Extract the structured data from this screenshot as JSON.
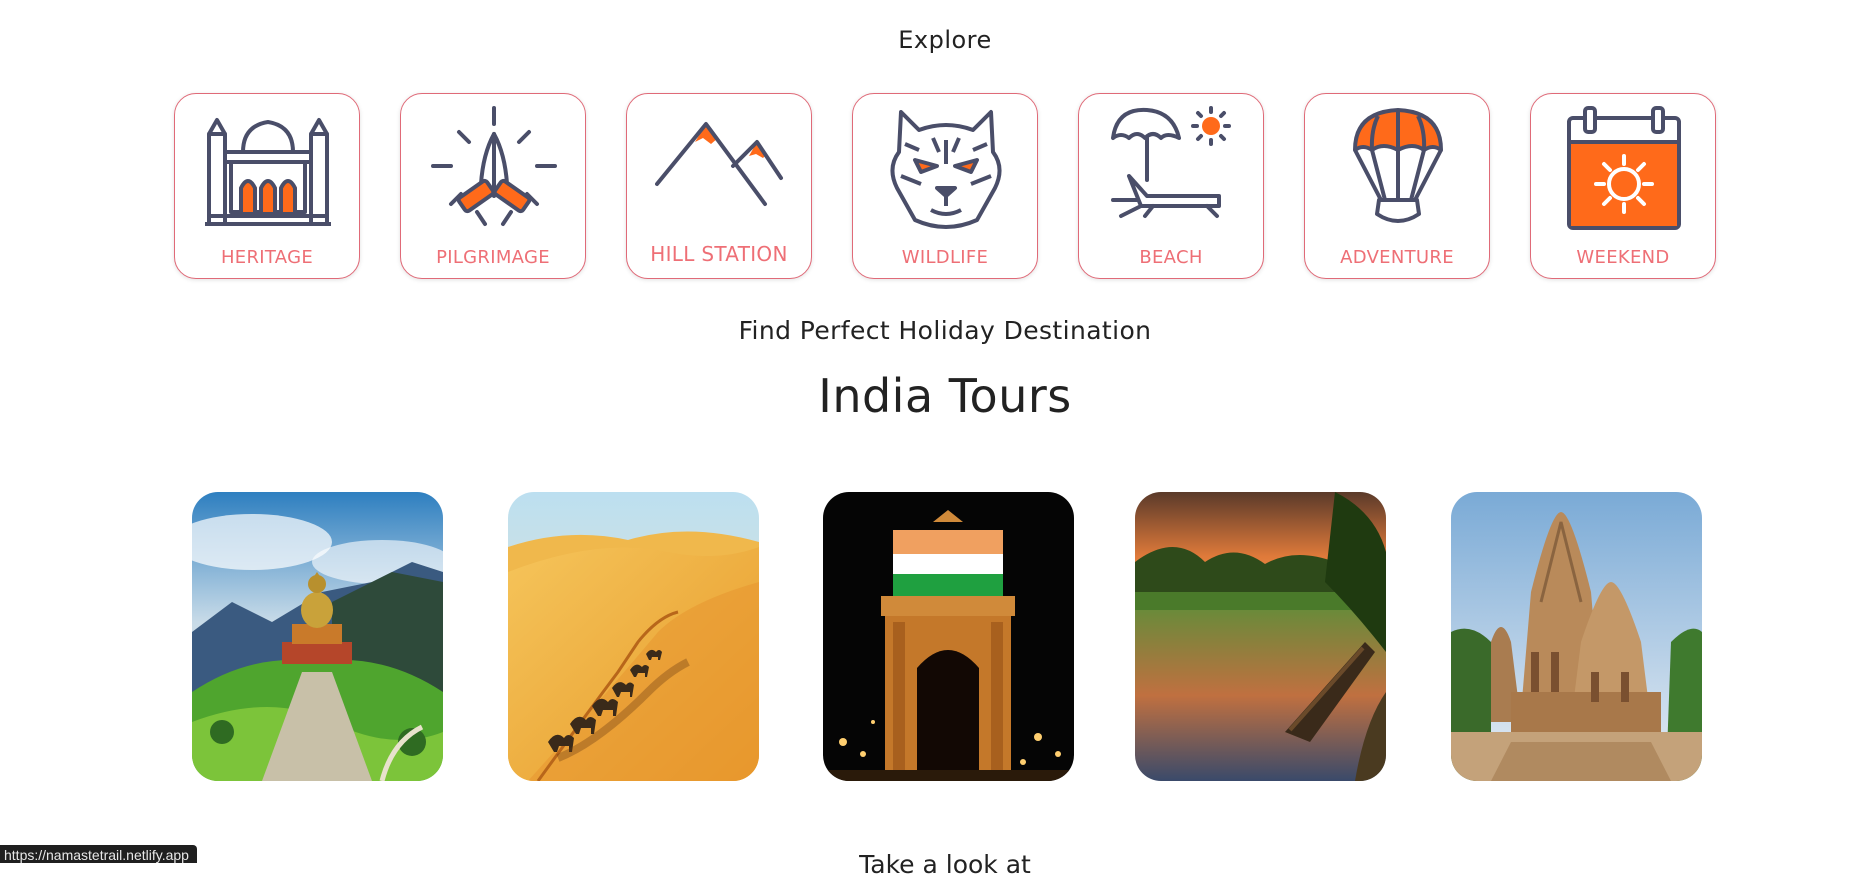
{
  "explore": {
    "title": "Explore"
  },
  "categories": [
    {
      "label": "HERITAGE",
      "icon": "mosque-icon"
    },
    {
      "label": "PILGRIMAGE",
      "icon": "praying-hands-icon"
    },
    {
      "label": "HILL STATION",
      "icon": "mountain-icon"
    },
    {
      "label": "WILDLIFE",
      "icon": "tiger-icon"
    },
    {
      "label": "BEACH",
      "icon": "beach-chair-icon"
    },
    {
      "label": "ADVENTURE",
      "icon": "hot-air-balloon-icon"
    },
    {
      "label": "WEEKEND",
      "icon": "calendar-sun-icon"
    }
  ],
  "tours": {
    "subtitle": "Find Perfect Holiday Destination",
    "title": "India Tours",
    "destinations": [
      {
        "image": "buddha-statue-hills-image"
      },
      {
        "image": "desert-camel-caravan-image"
      },
      {
        "image": "india-gate-night-image"
      },
      {
        "image": "backwater-boat-sunset-image"
      },
      {
        "image": "khajuraho-temple-image"
      }
    ]
  },
  "next_section": {
    "title": "Take a look at"
  },
  "status_bar": {
    "url": "https://namastetrail.netlify.app"
  },
  "colors": {
    "accent": "#ff6a1a",
    "border": "#e06a78",
    "label": "#ee6f76",
    "icon_stroke": "#4a4e69"
  }
}
